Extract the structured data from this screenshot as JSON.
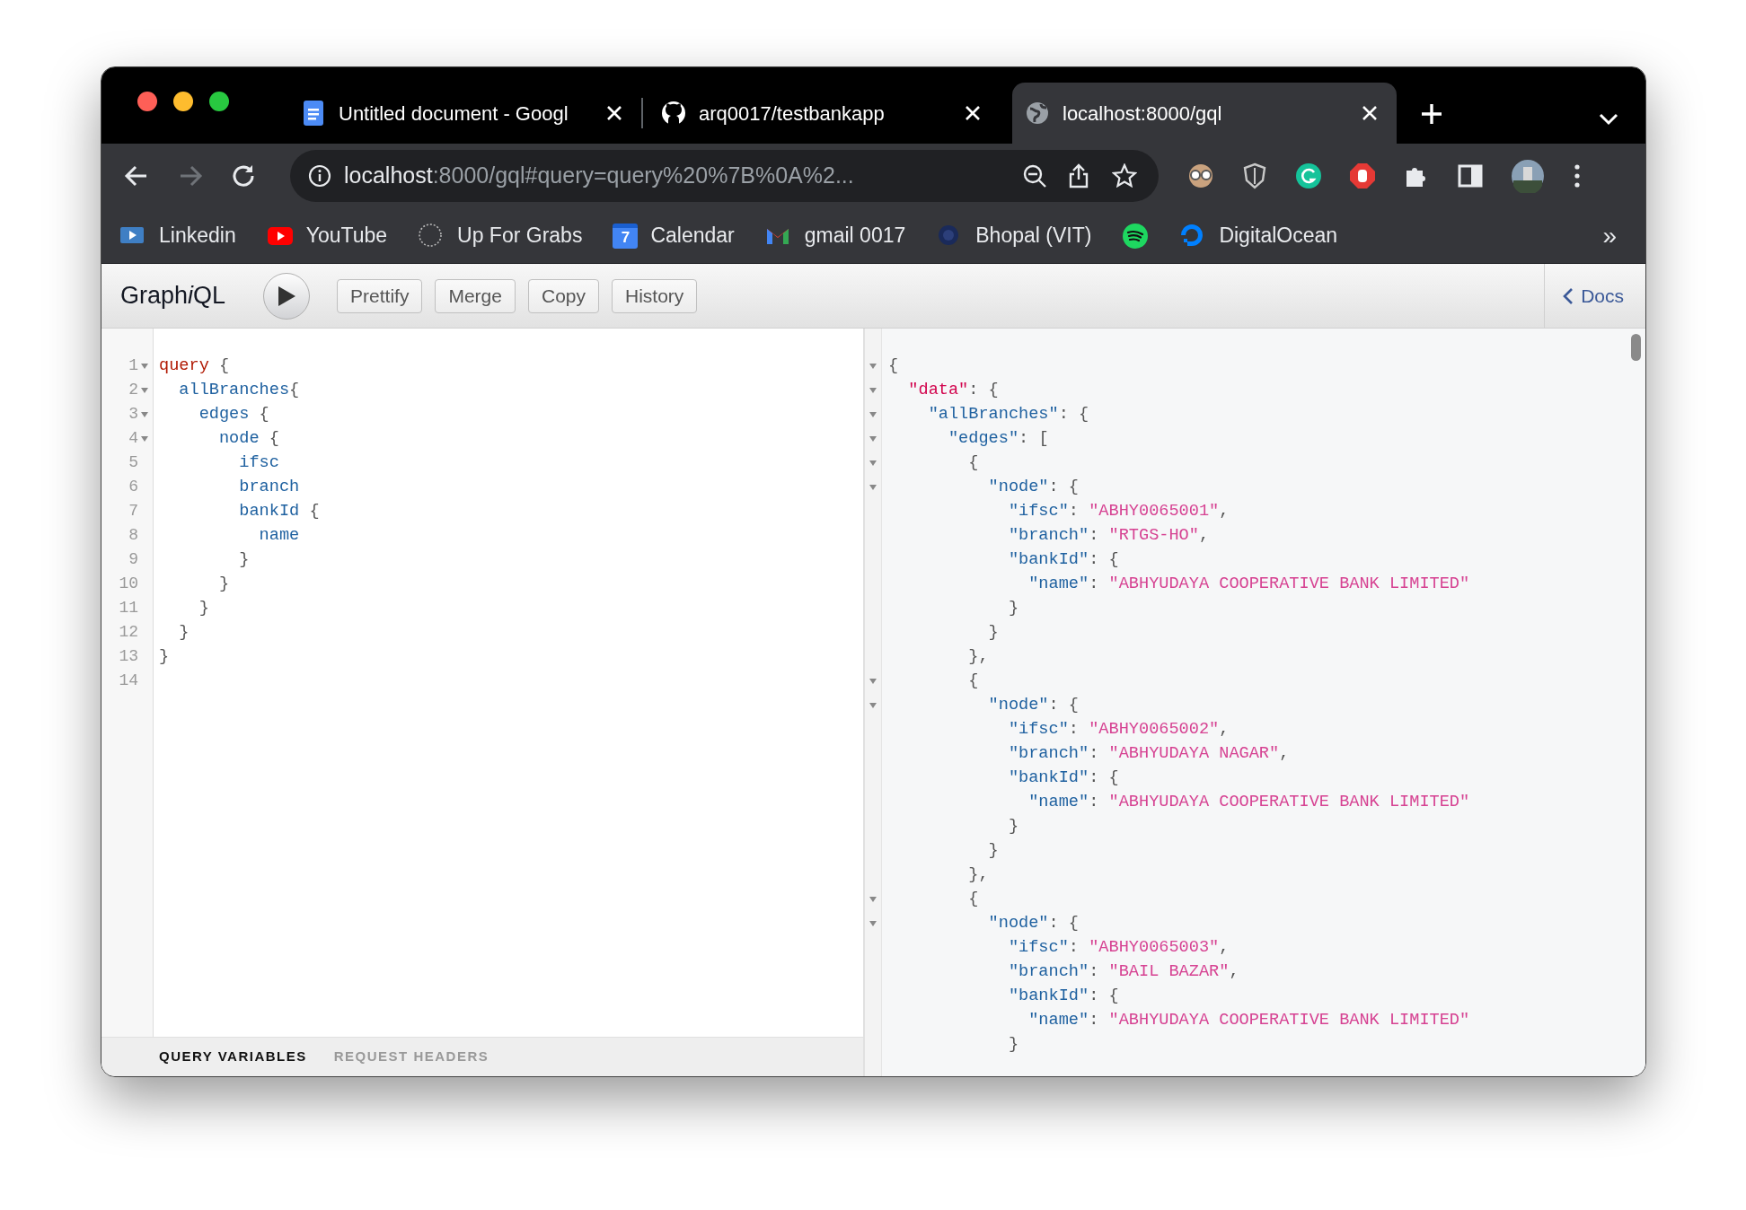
{
  "tabs": [
    {
      "kind": "docs",
      "title": "Untitled document - Googl",
      "selected": false
    },
    {
      "kind": "github",
      "title": "arq0017/testbankapp",
      "selected": false
    },
    {
      "kind": "globe",
      "title": "localhost:8000/gql",
      "selected": true
    }
  ],
  "nav_buttons": [
    {
      "kind": "back",
      "disabled": false
    },
    {
      "kind": "forward",
      "disabled": true
    },
    {
      "kind": "reload",
      "disabled": false
    }
  ],
  "address": {
    "host": "localhost",
    "rest": ":8000/gql#query=query%20%7B%0A%2..."
  },
  "extensions": [
    {
      "kind": "glasses"
    },
    {
      "kind": "shield"
    },
    {
      "kind": "green-circle"
    },
    {
      "kind": "stop"
    },
    {
      "kind": "puzzle"
    },
    {
      "kind": "sidebar"
    },
    {
      "kind": "avatar"
    },
    {
      "kind": "menu"
    }
  ],
  "bookmarks": [
    {
      "kind": "video",
      "label": "Linkedin"
    },
    {
      "kind": "play",
      "label": "YouTube"
    },
    {
      "kind": "dashed",
      "label": "Up For Grabs"
    },
    {
      "kind": "calendar",
      "icon_text": "7",
      "label": "Calendar"
    },
    {
      "kind": "mail",
      "label": "gmail 0017"
    },
    {
      "kind": "emblem",
      "label": "Bhopal (VIT)"
    },
    {
      "kind": "music"
    },
    {
      "kind": "ring",
      "label": "DigitalOcean"
    }
  ],
  "bookmarks_more": "»",
  "graphiql": {
    "title": [
      {
        "text": "Graph",
        "italic": false
      },
      {
        "text": "i",
        "italic": true
      },
      {
        "text": "QL",
        "italic": false
      }
    ],
    "buttons": [
      "Prettify",
      "Merge",
      "Copy",
      "History"
    ],
    "docs": "Docs"
  },
  "query_lines": [
    {
      "number": "1",
      "foldable": true,
      "tokens": [
        {
          "kind": "keyword",
          "text": "query"
        },
        {
          "kind": "punct",
          "text": " {"
        }
      ]
    },
    {
      "number": "2",
      "foldable": true,
      "tokens": [
        {
          "kind": "field",
          "text": "  allBranches"
        },
        {
          "kind": "punct",
          "text": "{"
        }
      ]
    },
    {
      "number": "3",
      "foldable": true,
      "tokens": [
        {
          "kind": "field",
          "text": "    edges"
        },
        {
          "kind": "punct",
          "text": " {"
        }
      ]
    },
    {
      "number": "4",
      "foldable": true,
      "tokens": [
        {
          "kind": "field",
          "text": "      node"
        },
        {
          "kind": "punct",
          "text": " {"
        }
      ]
    },
    {
      "number": "5",
      "foldable": false,
      "tokens": [
        {
          "kind": "field",
          "text": "        ifsc"
        }
      ]
    },
    {
      "number": "6",
      "foldable": false,
      "tokens": [
        {
          "kind": "field",
          "text": "        branch"
        }
      ]
    },
    {
      "number": "7",
      "foldable": false,
      "tokens": [
        {
          "kind": "field",
          "text": "        bankId"
        },
        {
          "kind": "punct",
          "text": " {"
        }
      ]
    },
    {
      "number": "8",
      "foldable": false,
      "tokens": [
        {
          "kind": "field",
          "text": "          name"
        }
      ]
    },
    {
      "number": "9",
      "foldable": false,
      "tokens": [
        {
          "kind": "punct",
          "text": "        }"
        }
      ]
    },
    {
      "number": "10",
      "foldable": false,
      "tokens": [
        {
          "kind": "punct",
          "text": "      }"
        }
      ]
    },
    {
      "number": "11",
      "foldable": false,
      "tokens": [
        {
          "kind": "punct",
          "text": "    }"
        }
      ]
    },
    {
      "number": "12",
      "foldable": false,
      "tokens": [
        {
          "kind": "punct",
          "text": "  }"
        }
      ]
    },
    {
      "number": "13",
      "foldable": false,
      "tokens": [
        {
          "kind": "punct",
          "text": "}"
        }
      ]
    },
    {
      "number": "14",
      "foldable": false
    }
  ],
  "bottom_tabs": [
    {
      "label": "QUERY VARIABLES",
      "selected": true
    },
    {
      "label": "REQUEST HEADERS",
      "selected": false
    }
  ],
  "result_lines": [
    {
      "foldable": true,
      "tokens": [
        {
          "kind": "punct",
          "text": "{"
        }
      ]
    },
    {
      "foldable": true,
      "tokens": [
        {
          "kind": "datakey",
          "text": "  \"data\""
        },
        {
          "kind": "punct",
          "text": ": {"
        }
      ]
    },
    {
      "foldable": true,
      "tokens": [
        {
          "kind": "key",
          "text": "    \"allBranches\""
        },
        {
          "kind": "punct",
          "text": ": {"
        }
      ]
    },
    {
      "foldable": true,
      "tokens": [
        {
          "kind": "key",
          "text": "      \"edges\""
        },
        {
          "kind": "punct",
          "text": ": ["
        }
      ]
    },
    {
      "foldable": true,
      "tokens": [
        {
          "kind": "punct",
          "text": "        {"
        }
      ]
    },
    {
      "foldable": true,
      "tokens": [
        {
          "kind": "key",
          "text": "          \"node\""
        },
        {
          "kind": "punct",
          "text": ": {"
        }
      ]
    },
    {
      "foldable": false,
      "tokens": [
        {
          "kind": "key",
          "text": "            \"ifsc\""
        },
        {
          "kind": "punct",
          "text": ": "
        },
        {
          "kind": "string",
          "text": "\"ABHY0065001\""
        },
        {
          "kind": "punct",
          "text": ","
        }
      ]
    },
    {
      "foldable": false,
      "tokens": [
        {
          "kind": "key",
          "text": "            \"branch\""
        },
        {
          "kind": "punct",
          "text": ": "
        },
        {
          "kind": "string",
          "text": "\"RTGS-HO\""
        },
        {
          "kind": "punct",
          "text": ","
        }
      ]
    },
    {
      "foldable": false,
      "tokens": [
        {
          "kind": "key",
          "text": "            \"bankId\""
        },
        {
          "kind": "punct",
          "text": ": {"
        }
      ]
    },
    {
      "foldable": false,
      "tokens": [
        {
          "kind": "key",
          "text": "              \"name\""
        },
        {
          "kind": "punct",
          "text": ": "
        },
        {
          "kind": "string",
          "text": "\"ABHYUDAYA COOPERATIVE BANK LIMITED\""
        }
      ]
    },
    {
      "foldable": false,
      "tokens": [
        {
          "kind": "punct",
          "text": "            }"
        }
      ]
    },
    {
      "foldable": false,
      "tokens": [
        {
          "kind": "punct",
          "text": "          }"
        }
      ]
    },
    {
      "foldable": false,
      "tokens": [
        {
          "kind": "punct",
          "text": "        },"
        }
      ]
    },
    {
      "foldable": true,
      "tokens": [
        {
          "kind": "punct",
          "text": "        {"
        }
      ]
    },
    {
      "foldable": true,
      "tokens": [
        {
          "kind": "key",
          "text": "          \"node\""
        },
        {
          "kind": "punct",
          "text": ": {"
        }
      ]
    },
    {
      "foldable": false,
      "tokens": [
        {
          "kind": "key",
          "text": "            \"ifsc\""
        },
        {
          "kind": "punct",
          "text": ": "
        },
        {
          "kind": "string",
          "text": "\"ABHY0065002\""
        },
        {
          "kind": "punct",
          "text": ","
        }
      ]
    },
    {
      "foldable": false,
      "tokens": [
        {
          "kind": "key",
          "text": "            \"branch\""
        },
        {
          "kind": "punct",
          "text": ": "
        },
        {
          "kind": "string",
          "text": "\"ABHYUDAYA NAGAR\""
        },
        {
          "kind": "punct",
          "text": ","
        }
      ]
    },
    {
      "foldable": false,
      "tokens": [
        {
          "kind": "key",
          "text": "            \"bankId\""
        },
        {
          "kind": "punct",
          "text": ": {"
        }
      ]
    },
    {
      "foldable": false,
      "tokens": [
        {
          "kind": "key",
          "text": "              \"name\""
        },
        {
          "kind": "punct",
          "text": ": "
        },
        {
          "kind": "string",
          "text": "\"ABHYUDAYA COOPERATIVE BANK LIMITED\""
        }
      ]
    },
    {
      "foldable": false,
      "tokens": [
        {
          "kind": "punct",
          "text": "            }"
        }
      ]
    },
    {
      "foldable": false,
      "tokens": [
        {
          "kind": "punct",
          "text": "          }"
        }
      ]
    },
    {
      "foldable": false,
      "tokens": [
        {
          "kind": "punct",
          "text": "        },"
        }
      ]
    },
    {
      "foldable": true,
      "tokens": [
        {
          "kind": "punct",
          "text": "        {"
        }
      ]
    },
    {
      "foldable": true,
      "tokens": [
        {
          "kind": "key",
          "text": "          \"node\""
        },
        {
          "kind": "punct",
          "text": ": {"
        }
      ]
    },
    {
      "foldable": false,
      "tokens": [
        {
          "kind": "key",
          "text": "            \"ifsc\""
        },
        {
          "kind": "punct",
          "text": ": "
        },
        {
          "kind": "string",
          "text": "\"ABHY0065003\""
        },
        {
          "kind": "punct",
          "text": ","
        }
      ]
    },
    {
      "foldable": false,
      "tokens": [
        {
          "kind": "key",
          "text": "            \"branch\""
        },
        {
          "kind": "punct",
          "text": ": "
        },
        {
          "kind": "string",
          "text": "\"BAIL BAZAR\""
        },
        {
          "kind": "punct",
          "text": ","
        }
      ]
    },
    {
      "foldable": false,
      "tokens": [
        {
          "kind": "key",
          "text": "            \"bankId\""
        },
        {
          "kind": "punct",
          "text": ": {"
        }
      ]
    },
    {
      "foldable": false,
      "tokens": [
        {
          "kind": "key",
          "text": "              \"name\""
        },
        {
          "kind": "punct",
          "text": ": "
        },
        {
          "kind": "string",
          "text": "\"ABHYUDAYA COOPERATIVE BANK LIMITED\""
        }
      ]
    },
    {
      "foldable": false,
      "tokens": [
        {
          "kind": "punct",
          "text": "            }"
        }
      ]
    }
  ]
}
